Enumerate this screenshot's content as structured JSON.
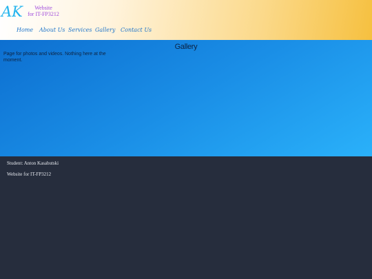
{
  "header": {
    "logo": "AK",
    "subtitle_line1": "Website",
    "subtitle_line2": "for IT-FP3212"
  },
  "nav": {
    "items": [
      {
        "label": "Home"
      },
      {
        "label": "About Us"
      },
      {
        "label": "Services"
      },
      {
        "label": "Gallery"
      },
      {
        "label": "Contact Us"
      }
    ]
  },
  "main": {
    "title": "Gallery",
    "text": "Page for photos and videos. Nothing here at the moment."
  },
  "footer": {
    "student": "Student: Anton Kasabutski",
    "site": "Website for IT-FP3212"
  },
  "colors": {
    "logo": "#23b4ee",
    "subtitle": "#a04bdb",
    "nav": "#1d74c9",
    "footer_bg": "#262d3d"
  }
}
